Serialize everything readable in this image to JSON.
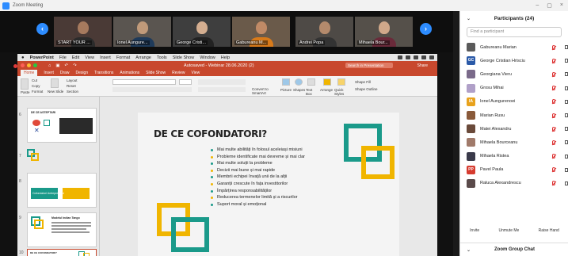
{
  "window": {
    "title": "Zoom Meeting",
    "controls": [
      "–",
      "▢",
      "×"
    ]
  },
  "strip": {
    "prev_arrow": "‹",
    "next_arrow": "›",
    "thumbnails": [
      {
        "name": "START YOUR ..."
      },
      {
        "name": "Ionel Aungure..."
      },
      {
        "name": "George Cristi..."
      },
      {
        "name": "Gabureanu M..."
      },
      {
        "name": "Andrei Popa"
      },
      {
        "name": "Mihaela Bour..."
      }
    ]
  },
  "mac_menu": {
    "items": [
      "PowerPoint",
      "File",
      "Edit",
      "View",
      "Insert",
      "Format",
      "Arrange",
      "Tools",
      "Slide Show",
      "Window",
      "Help"
    ]
  },
  "ppt": {
    "doc_title": "Autosaved - Webinar 28.06.2020 (2)",
    "search_placeholder": "Search in Presentation",
    "share_label": "Share",
    "tabs": [
      "Home",
      "Insert",
      "Draw",
      "Design",
      "Transitions",
      "Animations",
      "Slide Show",
      "Review",
      "View"
    ],
    "ribbon": {
      "cut": "Cut",
      "copy": "Copy",
      "format": "Format",
      "paste": "Paste",
      "new_slide": "New Slide",
      "layout": "Layout",
      "reset": "Reset",
      "section": "Section",
      "convert": "Convert to SmartArt",
      "picture": "Picture",
      "shapes": "Shapes",
      "text_box": "Text Box",
      "arrange": "Arrange",
      "quick_styles": "Quick Styles",
      "shape_fill": "Shape Fill",
      "shape_outline": "Shape Outline"
    },
    "slide_thumbs": [
      {
        "num": "6",
        "title": "DE CE ASTEPTARI"
      },
      {
        "num": "7",
        "title": ""
      },
      {
        "num": "8",
        "title": "Cofondatori  Antreprenorul"
      },
      {
        "num": "9",
        "title": "Modelul Indian Tango"
      },
      {
        "num": "10",
        "title": "DE CE COFONDATORI?"
      }
    ],
    "slide": {
      "heading": "DE CE COFONDATORI?",
      "bullets": [
        "Mai multe abilități în folosul aceleiași misiuni",
        "Probleme identificate mai devreme și mai clar",
        "Mai multe soluții la probleme",
        "Decizii mai bune și mai rapide",
        "Membrii echipei învață unii de la alții",
        "Garanții crescute în fața investitorilor",
        "Împărțirea responsabilităților",
        "Reducerea termenelor limită și a riscurilor",
        "Suport moral și emoțional"
      ]
    }
  },
  "participants": {
    "title": "Participants (24)",
    "search_placeholder": "Find a participant",
    "list": [
      {
        "name": "Gabureanu Marian",
        "initials": "",
        "color": "#5a5a5a"
      },
      {
        "name": "George Cristian Hrisciu",
        "initials": "GC",
        "color": "#2b5aa8"
      },
      {
        "name": "Georgiana Vieru",
        "initials": "",
        "color": "#7a6a8a"
      },
      {
        "name": "Grosu Mihai",
        "initials": "",
        "color": "#b0a0c8"
      },
      {
        "name": "Ionel Aungurenoei",
        "initials": "IA",
        "color": "#e8a21c"
      },
      {
        "name": "Marian Rusu",
        "initials": "",
        "color": "#8a5a3a"
      },
      {
        "name": "Matei Alexandru",
        "initials": "",
        "color": "#6a4a3a"
      },
      {
        "name": "Mihaela Bourceanu",
        "initials": "",
        "color": "#a07a6a"
      },
      {
        "name": "Mihaela Ristea",
        "initials": "",
        "color": "#3a3a4a"
      },
      {
        "name": "Pavel Paula",
        "initials": "PP",
        "color": "#d63b2f"
      },
      {
        "name": "Raluca Alexandrescu",
        "initials": "",
        "color": "#5a4a4a"
      }
    ],
    "buttons": [
      "Invite",
      "Unmute Me",
      "Raise Hand"
    ],
    "chat_title": "Zoom Group Chat"
  },
  "colors": {
    "teal": "#1a9a8a",
    "yellow": "#f0b500",
    "ppt_red": "#c8482d",
    "zoom_blue": "#2d8cff"
  }
}
